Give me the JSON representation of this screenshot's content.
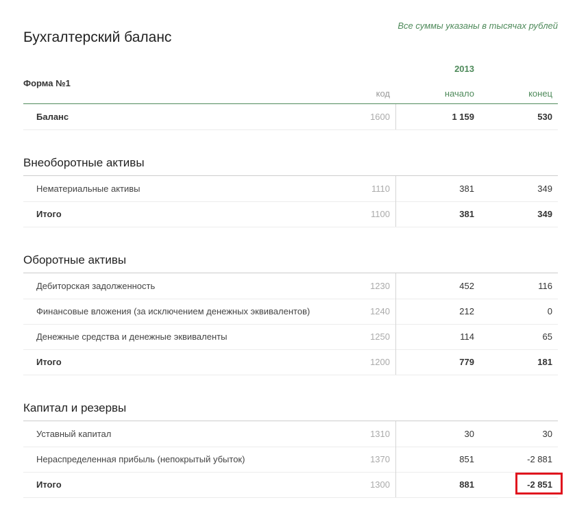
{
  "note": "Все суммы указаны в тысячах рублей",
  "title": "Бухгалтерский баланс",
  "form_label": "Форма №1",
  "year": "2013",
  "columns": {
    "code": "код",
    "start": "начало",
    "end": "конец"
  },
  "balance": {
    "name": "Баланс",
    "code": "1600",
    "start": "1 159",
    "end": "530"
  },
  "sections": [
    {
      "title": "Внеоборотные активы",
      "rows": [
        {
          "name": "Нематериальные активы",
          "code": "1110",
          "start": "381",
          "end": "349"
        },
        {
          "name": "Итого",
          "code": "1100",
          "start": "381",
          "end": "349"
        }
      ]
    },
    {
      "title": "Оборотные активы",
      "rows": [
        {
          "name": "Дебиторская задолженность",
          "code": "1230",
          "start": "452",
          "end": "116"
        },
        {
          "name": "Финансовые вложения (за исключением денежных эквивалентов)",
          "code": "1240",
          "start": "212",
          "end": "0"
        },
        {
          "name": "Денежные средства и денежные эквиваленты",
          "code": "1250",
          "start": "114",
          "end": "65"
        },
        {
          "name": "Итого",
          "code": "1200",
          "start": "779",
          "end": "181"
        }
      ]
    },
    {
      "title": "Капитал и резервы",
      "rows": [
        {
          "name": "Уставный капитал",
          "code": "1310",
          "start": "30",
          "end": "30"
        },
        {
          "name": "Нераспределенная прибыль (непокрытый убыток)",
          "code": "1370",
          "start": "851",
          "end": "-2 881"
        },
        {
          "name": "Итого",
          "code": "1300",
          "start": "881",
          "end": "-2 851"
        }
      ]
    }
  ],
  "highlight_color": "#e0141e",
  "accent_color": "#4e8a5a"
}
